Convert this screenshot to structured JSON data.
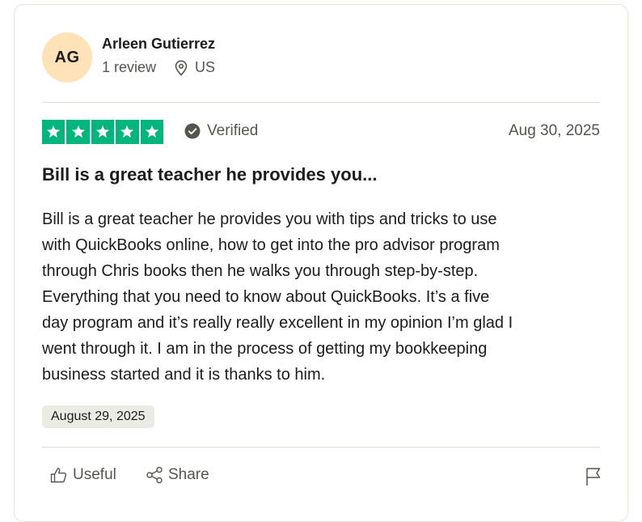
{
  "reviewer": {
    "initials": "AG",
    "name": "Arleen Gutierrez",
    "review_count": "1 review",
    "location": "US",
    "avatar_color": "#ffe2b8"
  },
  "rating": {
    "stars": 5,
    "max_stars": 5,
    "star_color": "#00b67a",
    "verified_label": "Verified"
  },
  "review": {
    "date": "Aug 30, 2025",
    "title": "Bill is a great teacher he provides you...",
    "lines": [
      "Bill is a great teacher he provides you with tips and tricks to use",
      "with QuickBooks online, how to get into the pro advisor program",
      "through Chris books then he walks you through step-by-step.",
      "Everything that you need to know about QuickBooks. It’s a five",
      "day program and it’s really really excellent in my opinion I’m glad I",
      "went through it. I am in the process of getting my bookkeeping",
      "business started and it is thanks to him."
    ],
    "experience_date": "August 29, 2025"
  },
  "actions": {
    "useful_label": "Useful",
    "share_label": "Share"
  },
  "icons": {
    "location": "location-pin-icon",
    "verified": "check-circle-icon",
    "useful": "thumbs-up-icon",
    "share": "share-icon",
    "report": "flag-icon"
  }
}
